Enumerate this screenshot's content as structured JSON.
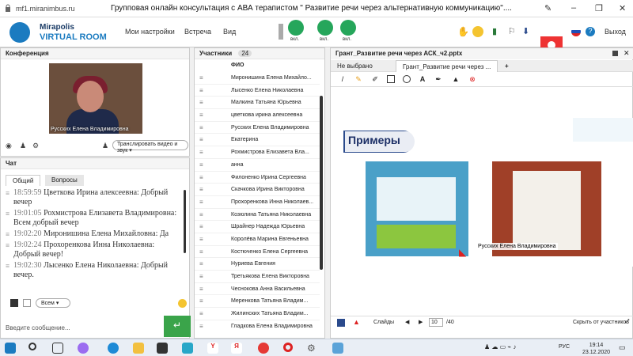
{
  "browser": {
    "url": "mf1.miranimbus.ru",
    "title": "Групповая онлайн консультация с АВА терапистом \" Развитие речи через альтернативную коммуникацию\"...."
  },
  "app": {
    "brand_line1": "Mirapolis",
    "brand_line2": "VIRTUAL ROOM",
    "menu": [
      "Мои настройки",
      "Встреча",
      "Вид"
    ],
    "controls": [
      {
        "label": "вкл."
      },
      {
        "label": "вкл."
      },
      {
        "label": "вкл."
      }
    ],
    "rec_label": "rec",
    "exit_label": "Выход"
  },
  "conference": {
    "title": "Конференция",
    "video_label": "Русских Елена Владимировна",
    "share_button": "Транслировать видео и звук"
  },
  "chat": {
    "title": "Чат",
    "tabs": [
      "Общий",
      "Вопросы"
    ],
    "messages": [
      {
        "time": "18:59:59",
        "text": "Цветкова  Ирина алексеевна: Добрый вечер"
      },
      {
        "time": "19:01:05",
        "text": "Рохмистрова  Елизавета Владимировна: Всем добрый вечер"
      },
      {
        "time": "19:02:20",
        "text": "Миронишина Елена Михайловна: Да"
      },
      {
        "time": "19:02:24",
        "text": "Прохоренкова Инна Николаевна: Добрый вечер!"
      },
      {
        "time": "19:02:30",
        "text": "Лысенко Елена  Николаевна: Добрый вечер."
      }
    ],
    "audience": "Всем",
    "input_placeholder": "Введите сообщение..."
  },
  "participants": {
    "title": "Участники",
    "count": "24",
    "column": "ФИО",
    "rows": [
      "Миронишина Елена  Михайло...",
      "Лысенко Елена  Николаевна",
      "Малкина Татьяна  Юрьевна",
      "цветкова  ирина алексеевна",
      "Русских Елена Владимировна",
      "Екатерина",
      "Рохмистрова  Елизавета Вла...",
      "анна",
      "Филоненко Ирина  Сергеевна",
      "Скачкова  Ирина Викторовна",
      "Прохоренкова Инна Николаев...",
      "Козюлина  Татьяна Николаевна",
      "Шрайнер Надежда  Юрьевна",
      "Королёва Марина Евгеньевна",
      "Костюченко  Елена  Сергеевна",
      "Нуриева Евгения",
      "Третьякова  Елена Викторовна",
      "Чеснокова  Анна  Васильевна",
      "Меренкова  Татьяна  Владим...",
      "Жилинских  Татьяна  Владим...",
      "Гладкова Елена Владимировна"
    ]
  },
  "whiteboard": {
    "title": "Грант_Развитие речи через АСК_ч2.pptx",
    "tabs": [
      "Не выбрано",
      "Грант_Развитие речи через ..."
    ],
    "slide_heading": "Примеры",
    "slide_caption": "Русских Елена Владимировна",
    "footer": {
      "slides_label": "Слайды",
      "page": "10",
      "total": "/40",
      "hide_label": "Скрыть от участников"
    }
  },
  "taskbar": {
    "lang": "РУС",
    "time": "19:14",
    "date": "23.12.2020"
  }
}
